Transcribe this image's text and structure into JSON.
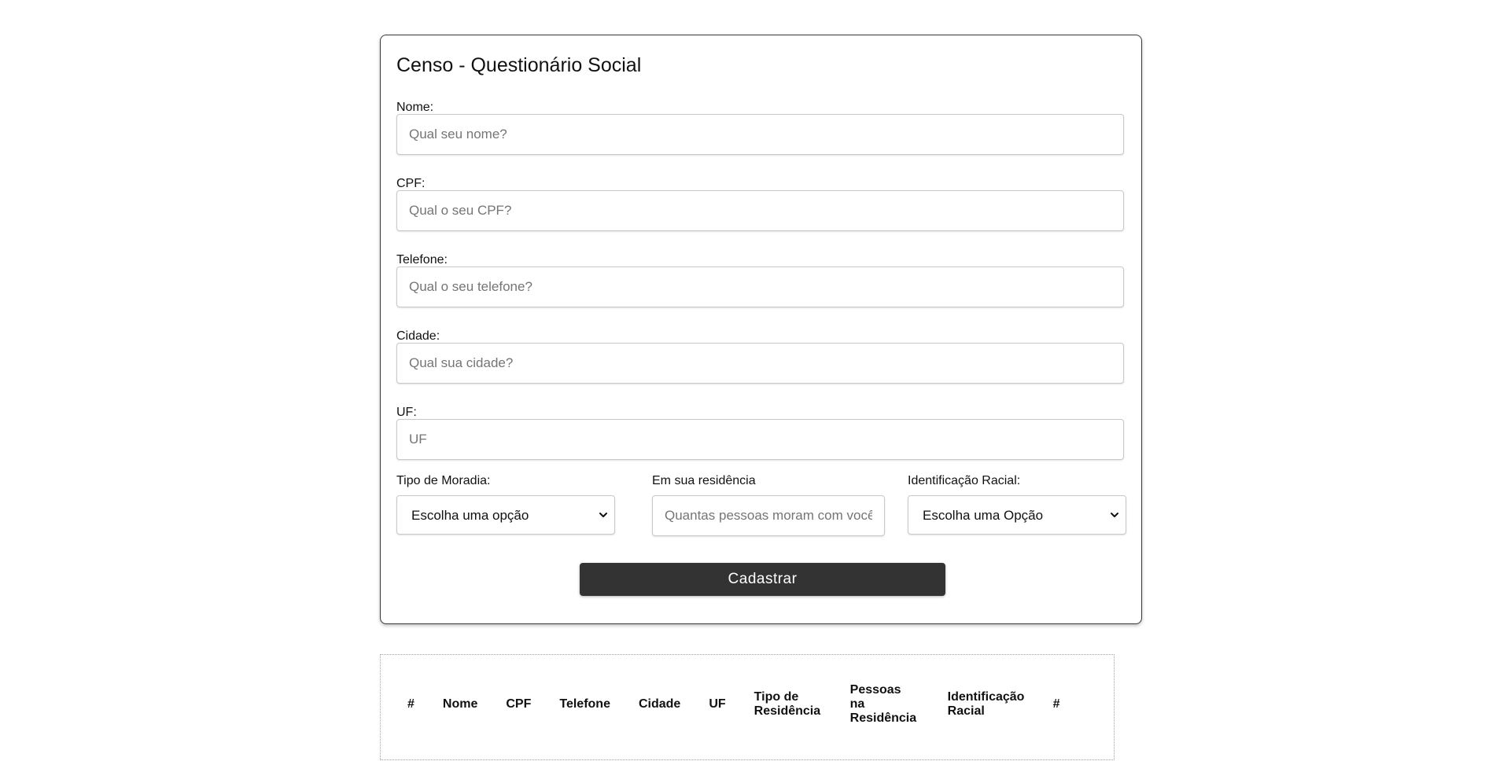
{
  "form": {
    "title": "Censo - Questionário Social",
    "fields": [
      {
        "label": "Nome:",
        "placeholder": "Qual seu nome?"
      },
      {
        "label": "CPF:",
        "placeholder": "Qual o seu CPF?"
      },
      {
        "label": "Telefone:",
        "placeholder": "Qual o seu telefone?"
      },
      {
        "label": "Cidade:",
        "placeholder": "Qual sua cidade?"
      },
      {
        "label": "UF:",
        "placeholder": "UF"
      }
    ],
    "moradia": {
      "label": "Tipo de Moradia:",
      "selected": "Escolha uma opção"
    },
    "residencia": {
      "label": "Em sua residência",
      "placeholder": "Quantas pessoas moram com você?"
    },
    "racial": {
      "label": "Identificação Racial:",
      "selected": "Escolha uma Opção"
    },
    "submit_label": "Cadastrar"
  },
  "table": {
    "headers": [
      "#",
      "Nome",
      "CPF",
      "Telefone",
      "Cidade",
      "UF",
      "Tipo de Residência",
      "Pessoas na Residência",
      "Identificação Racial",
      "#"
    ]
  },
  "colors": {
    "button_bg": "#333333",
    "border": "#3a3a3a"
  }
}
